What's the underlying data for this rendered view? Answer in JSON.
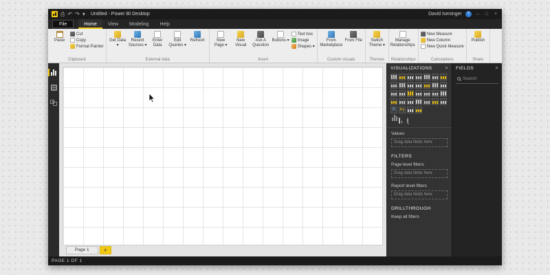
{
  "ui": {
    "chevron": ">",
    "add": "+"
  },
  "titlebar": {
    "save_icon": "⎙",
    "undo": "↶",
    "redo": "↷",
    "caret": "▾",
    "title": "Untitled - Power BI Desktop",
    "user": "David Iseninger",
    "help": "?",
    "minimize": "–",
    "maximize": "□",
    "close": "×"
  },
  "menu": {
    "file": "File",
    "tabs": [
      "Home",
      "View",
      "Modeling",
      "Help"
    ],
    "active_tab": "Home"
  },
  "ribbon": {
    "clipboard": {
      "label": "Clipboard",
      "paste": "Paste",
      "cut": "Cut",
      "copy": "Copy",
      "format_painter": "Format Painter"
    },
    "external_data": {
      "label": "External data",
      "get_data": "Get Data ▾",
      "recent_sources": "Recent Sources ▾",
      "enter_data": "Enter Data",
      "edit_queries": "Edit Queries ▾",
      "refresh": "Refresh"
    },
    "insert": {
      "label": "Insert",
      "new_page": "New Page ▾",
      "new_visual": "New Visual",
      "ask_a_question": "Ask A Question",
      "buttons": "Buttons ▾",
      "text_box": "Text box",
      "image": "Image",
      "shapes": "Shapes ▾"
    },
    "custom_visuals": {
      "label": "Custom visuals",
      "from_marketplace": "From Marketplace",
      "from_file": "From File"
    },
    "themes": {
      "label": "Themes",
      "switch_theme": "Switch Theme ▾"
    },
    "relationships": {
      "label": "Relationships",
      "manage_relationships": "Manage Relationships"
    },
    "calculations": {
      "label": "Calculations",
      "new_measure": "New Measure",
      "new_column": "New Column",
      "new_quick_measure": "New Quick Measure"
    },
    "share": {
      "label": "Share",
      "publish": "Publish"
    }
  },
  "visualizations": {
    "title": "VISUALIZATIONS",
    "icons": [
      "stacked-bar-chart",
      "stacked-column-chart",
      "clustered-bar-chart",
      "clustered-column-chart",
      "hundred-stacked-bar-chart",
      "hundred-stacked-column-chart",
      "line-chart",
      "area-chart",
      "stacked-area-chart",
      "line-clustered-column-chart",
      "line-stacked-column-chart",
      "ribbon-chart",
      "waterfall-chart",
      "scatter-chart",
      "pie-chart",
      "donut-chart",
      "treemap",
      "map",
      "filled-map",
      "shape-map",
      "funnel",
      "gauge",
      "card",
      "multi-row-card",
      "kpi",
      "slicer",
      "table",
      "matrix",
      "r-script-visual",
      "python-visual",
      "arcgis-map",
      "more-options"
    ],
    "icon_glyphs": {
      "r-script-visual": "R",
      "python-visual": "Py",
      "more-options": "…"
    },
    "values_label": "Values",
    "drop_hint": "Drag data fields here",
    "filters_title": "FILTERS",
    "page_level_label": "Page level filters",
    "page_level_hint": "Drag data fields here",
    "report_level_label": "Report level filters",
    "report_level_hint": "Drag data fields here",
    "drillthrough_title": "DRILLTHROUGH",
    "keep_all_filters": "Keep all filters"
  },
  "fields": {
    "title": "FIELDS",
    "search_placeholder": "Search"
  },
  "pages": {
    "tab": "Page 1"
  },
  "statusbar": {
    "text": "PAGE 1 OF 1"
  }
}
